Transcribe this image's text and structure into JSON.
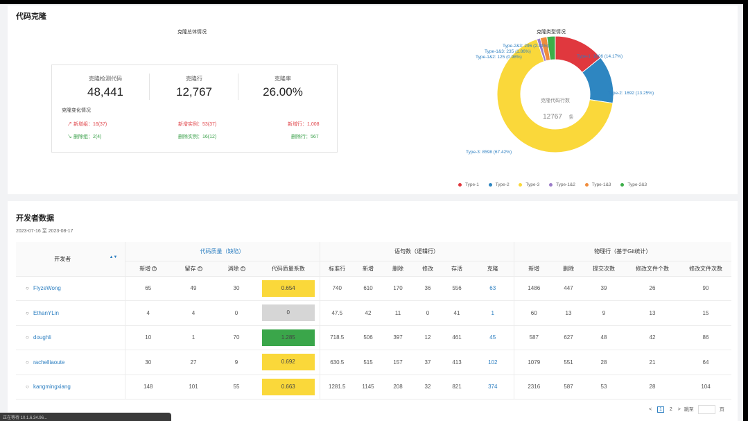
{
  "clone": {
    "title": "代码克隆",
    "summary_title": "克隆总体情况",
    "stats": [
      {
        "label": "克隆检测代码",
        "value": "48,441"
      },
      {
        "label": "克隆行",
        "value": "12,767"
      },
      {
        "label": "克隆率",
        "value": "26.00%"
      }
    ],
    "change_title": "克隆变化情况",
    "changes": {
      "new_group": "↗ 新增组：16(37)",
      "new_instance": "新增实例：53(37)",
      "new_line": "新增行：1,008",
      "del_group": "↘ 删除组：2(4)",
      "del_instance": "删除实例：16(12)",
      "del_line": "删除行：567"
    },
    "type_title": "克隆类型情况",
    "center_label": "克隆代码行数",
    "center_value": "12767",
    "center_unit": "条"
  },
  "chart_data": {
    "type": "pie",
    "title": "克隆类型情况",
    "categories": [
      "Type-1",
      "Type-2",
      "Type-3",
      "Type-1&2",
      "Type-1&3",
      "Type-2&3"
    ],
    "values": [
      1806,
      1692,
      8598,
      125,
      235,
      296
    ],
    "percents": [
      "14.17%",
      "13.25%",
      "67.42%",
      "0.98%",
      "1.86%",
      "2.31%"
    ],
    "slice_labels": [
      "Type-1: 1806 (14.17%)",
      "Type-2: 1692 (13.25%)",
      "Type-3: 8598 (67.42%)",
      "Type-1&2: 125 (0.98%)",
      "Type-1&3: 235 (1.86%)",
      "Type-2&3: 296 (2.31%)"
    ],
    "colors": [
      "#e0383e",
      "#2e86c1",
      "#fad83a",
      "#9b7cc8",
      "#f08c3c",
      "#3cae49"
    ],
    "legend_position": "bottom"
  },
  "dev": {
    "title": "开发者数据",
    "date_range": "2023-07-16 至 2023-08-17",
    "headers": {
      "developer": "开发者",
      "sort_icon": "▲▼",
      "quality_group": "代码质量（缺陷）",
      "stmt_group": "语句数（逻辑行）",
      "physical_group": "物理行（基于Git统计）",
      "q_new": "新增",
      "q_keep": "留存",
      "q_del": "消除",
      "q_coef": "代码质量系数",
      "s_std": "标准行",
      "s_new": "新增",
      "s_del": "删除",
      "s_mod": "修改",
      "s_live": "存活",
      "s_clone": "克隆",
      "p_new": "新增",
      "p_del": "删除",
      "p_commits": "提交次数",
      "p_files": "修改文件个数",
      "p_file_times": "修改文件次数",
      "q_icon": "?"
    },
    "rows": [
      {
        "name": "FlyzeWong",
        "q": [
          "65",
          "49",
          "30"
        ],
        "coef": "0.654",
        "coef_color": "#fad83a",
        "s": [
          "740",
          "610",
          "170",
          "36",
          "556"
        ],
        "clone": "63",
        "p": [
          "1486",
          "447",
          "39",
          "26",
          "90"
        ]
      },
      {
        "name": "EthanYLin",
        "q": [
          "4",
          "4",
          "0"
        ],
        "coef": "0",
        "coef_color": "#d6d6d6",
        "s": [
          "47.5",
          "42",
          "11",
          "0",
          "41"
        ],
        "clone": "1",
        "p": [
          "60",
          "13",
          "9",
          "13",
          "15"
        ]
      },
      {
        "name": "doughli",
        "q": [
          "10",
          "1",
          "70"
        ],
        "coef": "1.285",
        "coef_color": "#3aa64a",
        "s": [
          "718.5",
          "506",
          "397",
          "12",
          "461"
        ],
        "clone": "45",
        "p": [
          "587",
          "627",
          "48",
          "42",
          "86"
        ]
      },
      {
        "name": "rachelliaoute",
        "q": [
          "30",
          "27",
          "9"
        ],
        "coef": "0.692",
        "coef_color": "#fad83a",
        "s": [
          "630.5",
          "515",
          "157",
          "37",
          "413"
        ],
        "clone": "102",
        "p": [
          "1079",
          "551",
          "28",
          "21",
          "64"
        ]
      },
      {
        "name": "kangmingxiang",
        "q": [
          "148",
          "101",
          "55"
        ],
        "coef": "0.663",
        "coef_color": "#fad83a",
        "s": [
          "1281.5",
          "1145",
          "208",
          "32",
          "821"
        ],
        "clone": "374",
        "p": [
          "2316",
          "587",
          "53",
          "28",
          "104"
        ]
      }
    ],
    "pager": {
      "prev": "<",
      "pages": [
        "1",
        "2"
      ],
      "next": ">",
      "jump_label": "跳至",
      "page_unit": "页"
    }
  },
  "status_text": "正在等待 10.1.6.34.96..."
}
